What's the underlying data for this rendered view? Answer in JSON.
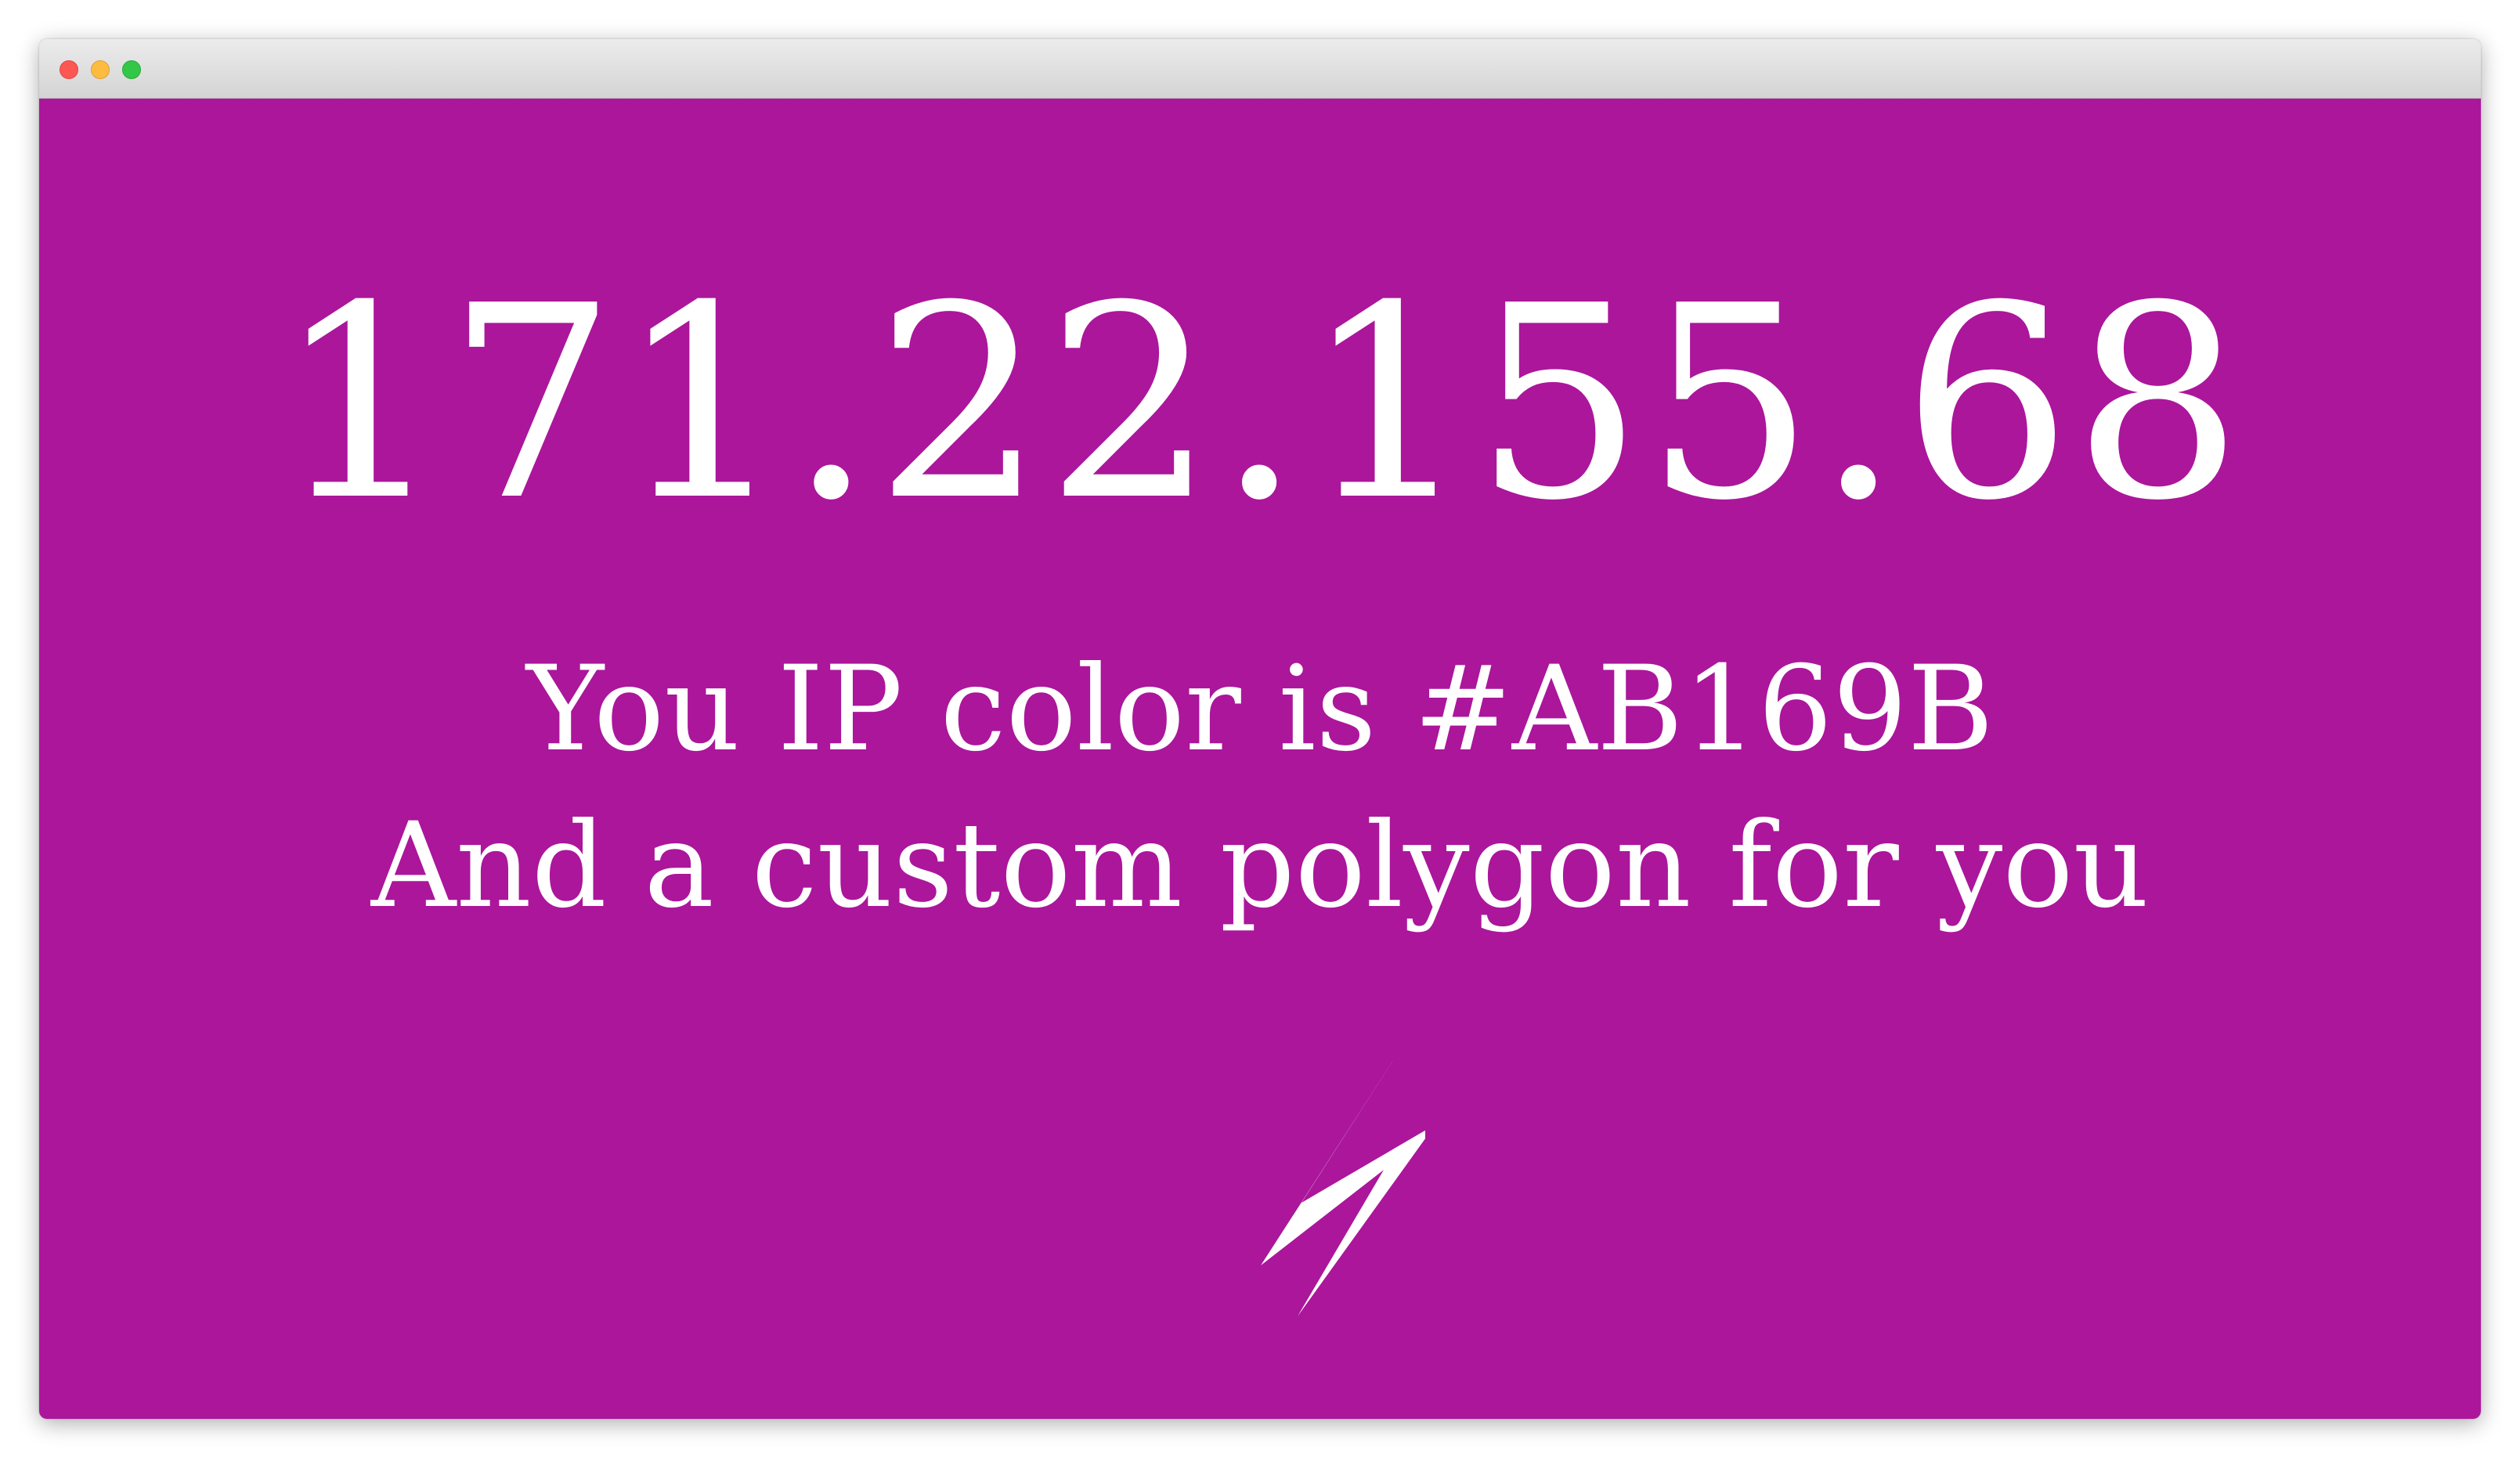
{
  "window": {
    "controls": [
      "close",
      "minimize",
      "zoom"
    ]
  },
  "page": {
    "background_color": "#AB169B",
    "ip_address": "171.22.155.68",
    "color_message": "You IP color is #AB169B",
    "polygon_message": "And a custom polygon for you",
    "polygon_icon": "lightning-polygon"
  }
}
